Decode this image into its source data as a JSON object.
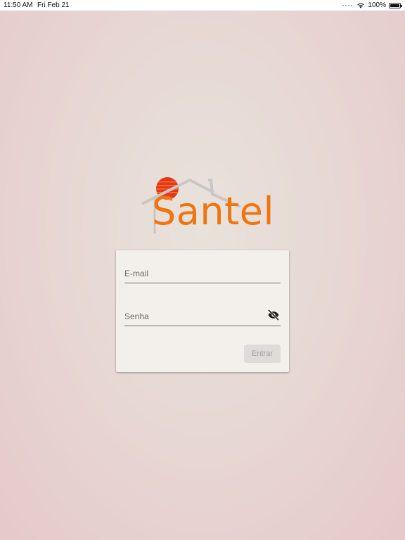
{
  "status_bar": {
    "time": "11:50 AM",
    "date": "Fri Feb 21",
    "battery": "100%"
  },
  "logo": {
    "text": "Santel",
    "brand_color": "#f07410",
    "sun_color": "#e8361c",
    "roof_color": "#c9c6c3"
  },
  "login_form": {
    "email_placeholder": "E-mail",
    "password_placeholder": "Senha",
    "submit_label": "Entrar",
    "password_visibility_icon": "eye-off-icon"
  },
  "colors": {
    "background": "#e7d8d4",
    "card_background": "#f3f0ec",
    "button_disabled_background": "#dedbd8",
    "button_disabled_text": "#a4a09c"
  }
}
